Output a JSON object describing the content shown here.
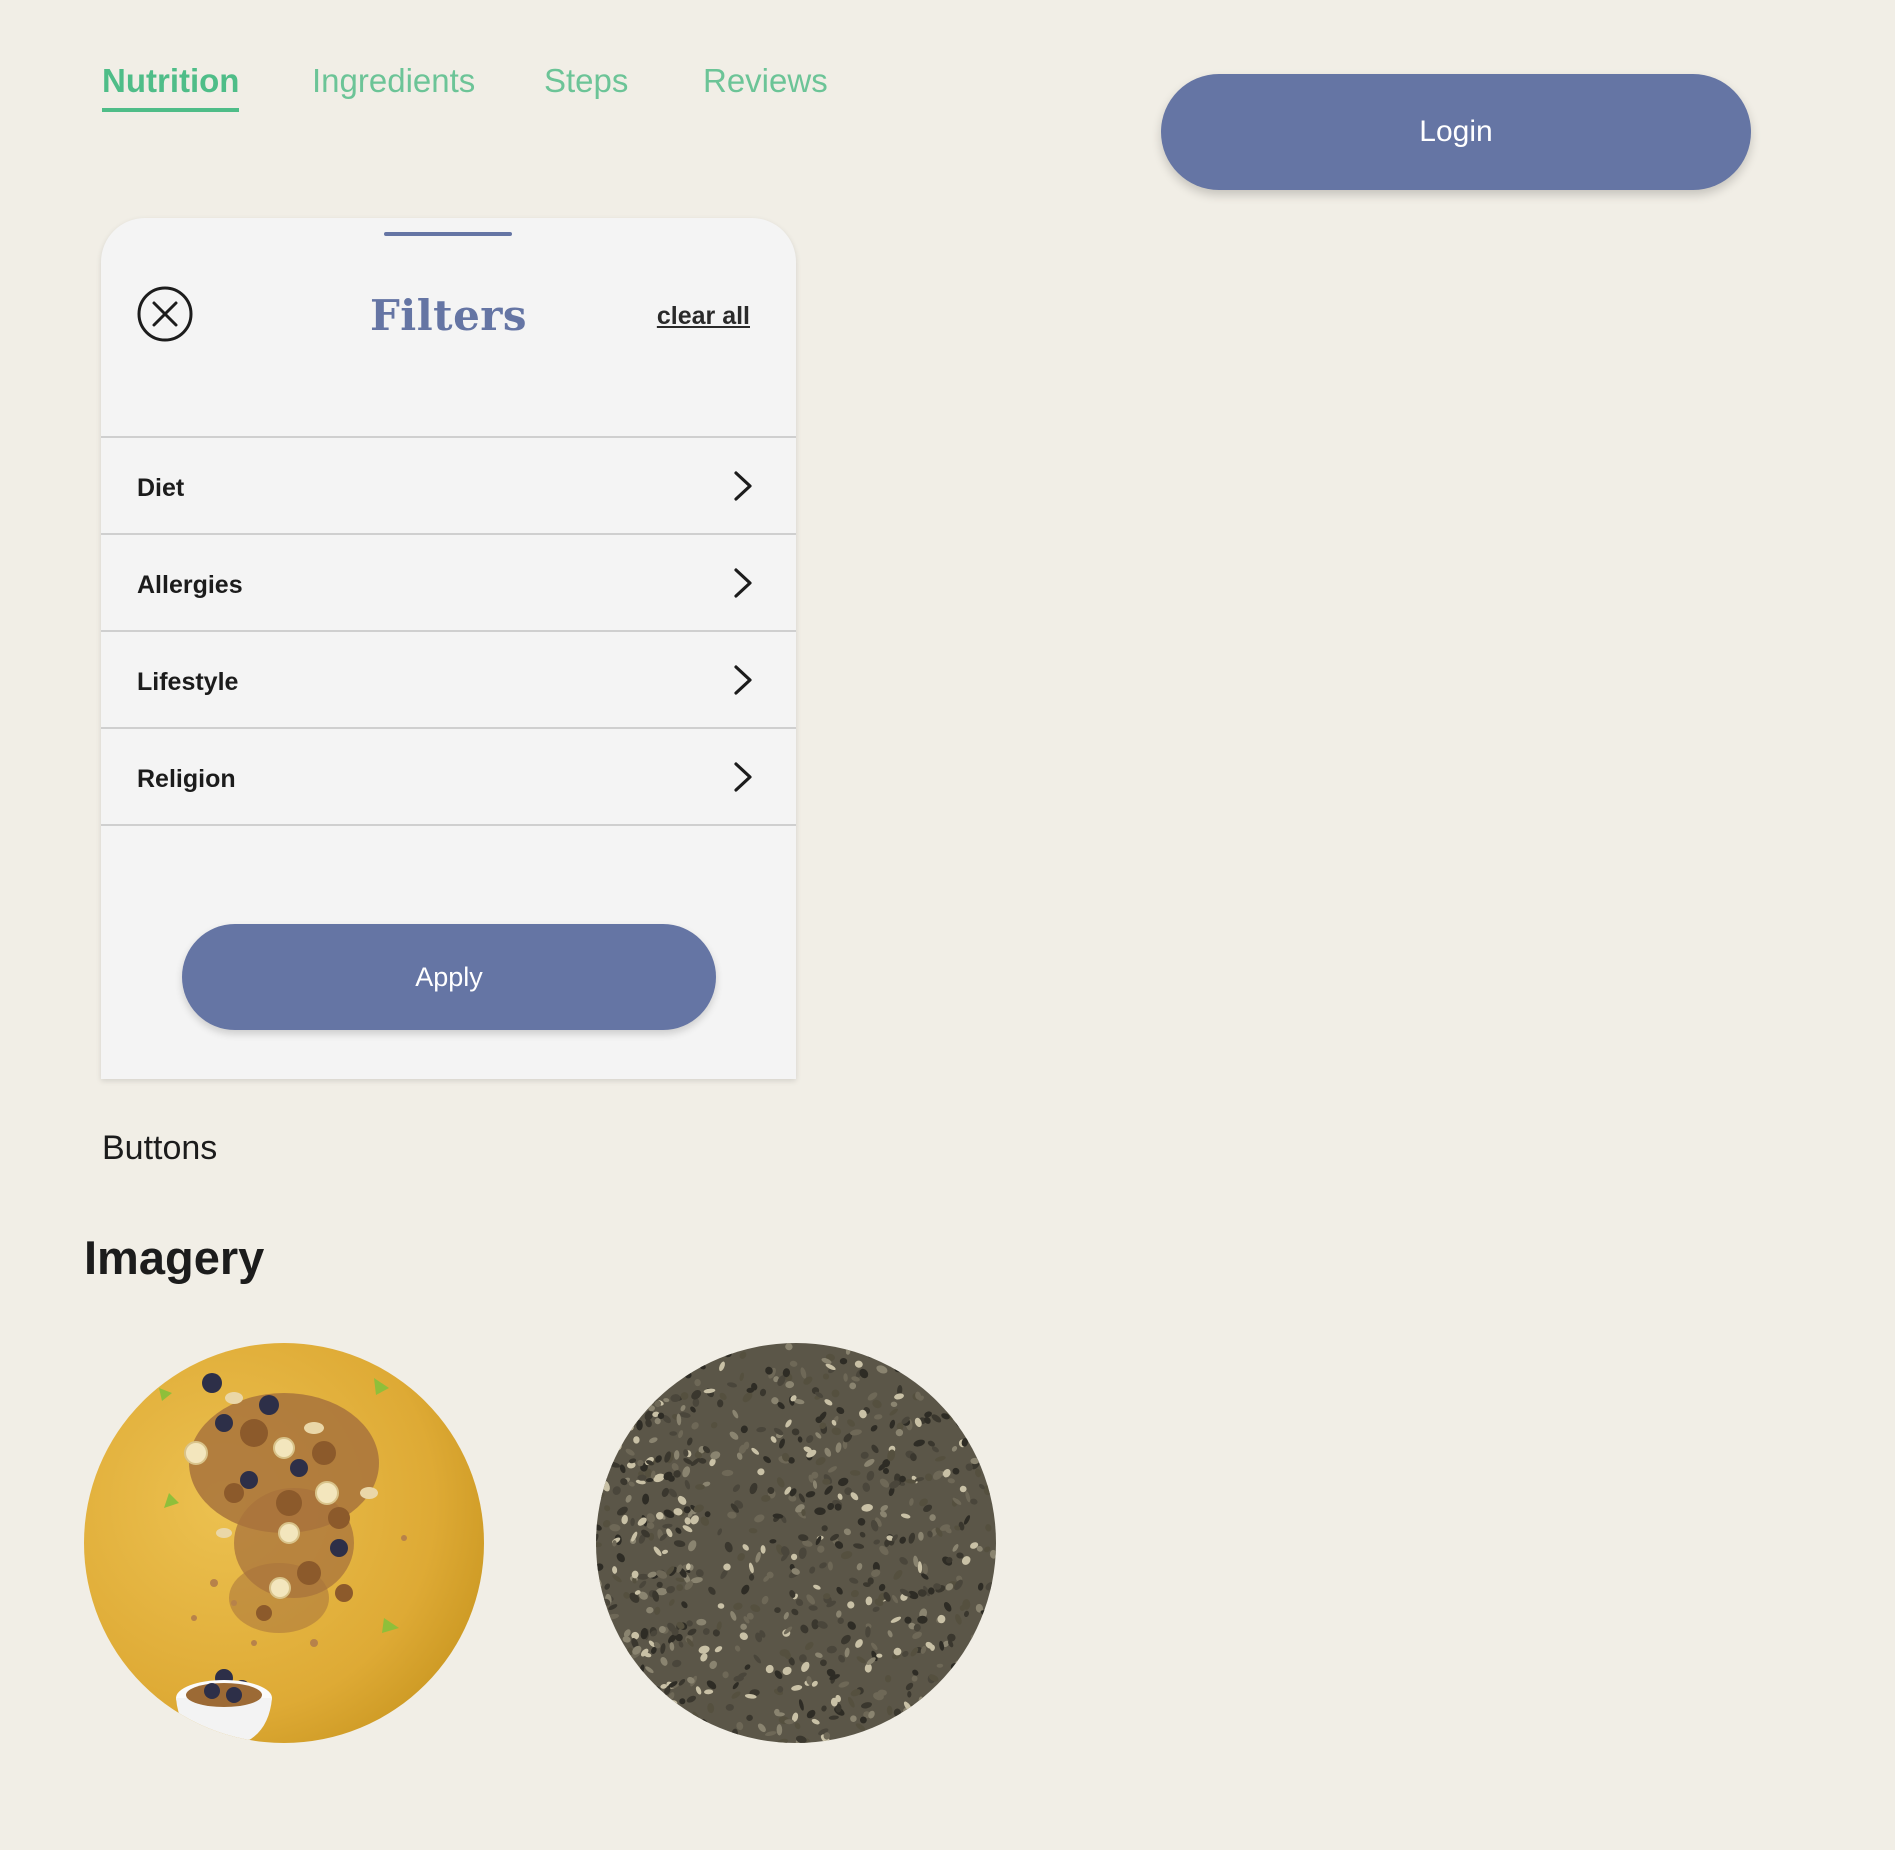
{
  "tabs": [
    {
      "label": "Nutrition",
      "active": true
    },
    {
      "label": "Ingredients",
      "active": false
    },
    {
      "label": "Steps",
      "active": false
    },
    {
      "label": "Reviews",
      "active": false
    }
  ],
  "header": {
    "login_label": "Login"
  },
  "filters_panel": {
    "title": "Filters",
    "clear_all_label": "clear all",
    "close_icon": "close-circle-icon",
    "items": [
      {
        "label": "Diet",
        "icon": "chevron-right-icon"
      },
      {
        "label": "Allergies",
        "icon": "chevron-right-icon"
      },
      {
        "label": "Lifestyle",
        "icon": "chevron-right-icon"
      },
      {
        "label": "Religion",
        "icon": "chevron-right-icon"
      }
    ],
    "apply_label": "Apply"
  },
  "sections": {
    "buttons_caption": "Buttons",
    "imagery_heading": "Imagery"
  },
  "imagery": [
    {
      "subject": "granola-with-blueberries-and-banana-on-yellow"
    },
    {
      "subject": "chia-seeds"
    }
  ],
  "colors": {
    "background": "#f1eee6",
    "accent_green": "#4fbd88",
    "primary_button": "#6575a4",
    "panel_background": "#f4f4f4",
    "divider": "#cfcfcf",
    "text_dark": "#1c1c1c"
  }
}
